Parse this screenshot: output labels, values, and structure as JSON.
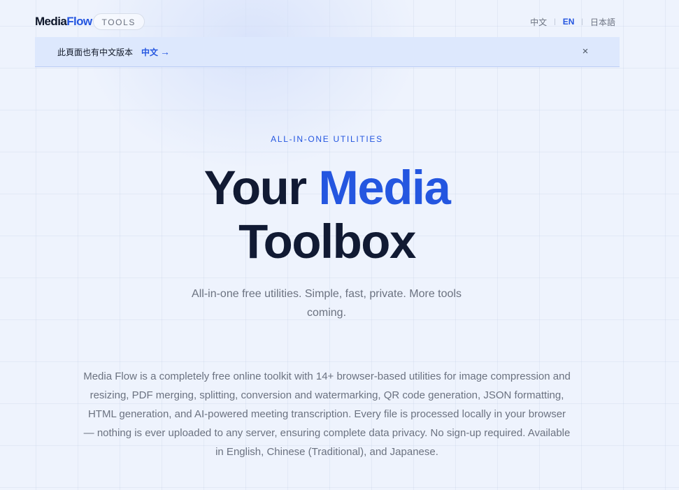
{
  "header": {
    "logo_part1": "Media",
    "logo_part2": "Flow",
    "badge": "TOOLS",
    "languages": [
      {
        "label": "中文",
        "active": false
      },
      {
        "label": "EN",
        "active": true
      },
      {
        "label": "日本語",
        "active": false
      }
    ],
    "separator": "|"
  },
  "notice": {
    "text": "此頁面也有中文版本",
    "link_label": "中文",
    "link_arrow": "→",
    "close_symbol": "×"
  },
  "hero": {
    "eyebrow": "ALL-IN-ONE UTILITIES",
    "title_part1": "Your",
    "title_accent": "Media",
    "title_line2": "Toolbox",
    "subtitle": "All-in-one free utilities. Simple, fast, private. More tools coming.",
    "description": "Media Flow is a completely free online toolkit with 14+ browser-based utilities for image compression and resizing, PDF merging, splitting, conversion and watermarking, QR code generation, JSON formatting, HTML generation, and AI-powered meeting transcription. Every file is processed locally in your browser — nothing is ever uploaded to any server, ensuring complete data privacy. No sign-up required. Available in English, Chinese (Traditional), and Japanese."
  },
  "colors": {
    "accent": "#2456e0",
    "heading": "#111a33",
    "muted_text": "#6b7280",
    "background": "#eef3fd",
    "notice_background": "#dde8fd"
  }
}
